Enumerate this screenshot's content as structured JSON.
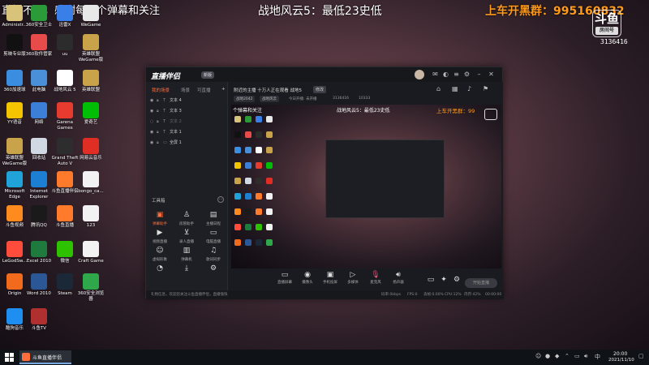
{
  "overlay": {
    "top_left": "直播不易，感谢每一个弹幕和关注",
    "top_center": "战地风云5：最低23史低",
    "top_right": "上车开黑群：995160832",
    "logo_text": "斗鱼",
    "logo_sub": "房间号",
    "room_id": "3136416"
  },
  "desktop_icons": [
    {
      "label": "Administr...",
      "icon": "user-folder-icon",
      "color": "#d9c27a"
    },
    {
      "label": "360安全卫士",
      "icon": "shield-360-icon",
      "color": "#2b9b3a"
    },
    {
      "label": "迅雷X",
      "icon": "thunder-icon",
      "color": "#3a7ee8"
    },
    {
      "label": "WeGame",
      "icon": "wegame-icon",
      "color": "#e8e8e8"
    },
    {
      "label": "剪映专业版",
      "icon": "capcut-icon",
      "color": "#111111"
    },
    {
      "label": "360软件管家",
      "icon": "software-manager-icon",
      "color": "#e94b4b"
    },
    {
      "label": "uu",
      "icon": "uu-icon",
      "color": "#2c2c2c"
    },
    {
      "label": "英雄联盟 WeGame版",
      "icon": "lol-icon",
      "color": "#c9a34a"
    },
    {
      "label": "360加速球",
      "icon": "speed-ball-icon",
      "color": "#3b8de0"
    },
    {
      "label": "此电脑",
      "icon": "computer-icon",
      "color": "#4a90d9"
    },
    {
      "label": "战地风云 5",
      "icon": "battlefield-icon",
      "color": "#ffffff"
    },
    {
      "label": "英雄联盟",
      "icon": "league-icon",
      "color": "#c9a34a"
    },
    {
      "label": "YY语音",
      "icon": "yy-icon",
      "color": "#f5c400"
    },
    {
      "label": "网络",
      "icon": "network-icon",
      "color": "#3c7fd6"
    },
    {
      "label": "Garena Games",
      "icon": "garena-icon",
      "color": "#e63b2e"
    },
    {
      "label": "爱奇艺",
      "icon": "iqiyi-icon",
      "color": "#00be06"
    },
    {
      "label": "英雄联盟 WeGame版",
      "icon": "lol-wegame-icon",
      "color": "#c9a34a"
    },
    {
      "label": "回收站",
      "icon": "recycle-bin-icon",
      "color": "#cfd8e3"
    },
    {
      "label": "Grand Theft Auto V",
      "icon": "gta-icon",
      "color": "#2d2d2d"
    },
    {
      "label": "网易云音乐",
      "icon": "netease-music-icon",
      "color": "#e02e24"
    },
    {
      "label": "Microsoft Edge",
      "icon": "edge-icon",
      "color": "#1fa3d9"
    },
    {
      "label": "Internet Explorer",
      "icon": "ie-icon",
      "color": "#1c7fd4"
    },
    {
      "label": "斗鱼直播伴侣",
      "icon": "douyu-icon",
      "color": "#ff7a2a"
    },
    {
      "label": "bongo_ca...",
      "icon": "file-icon",
      "color": "#f2f2f2"
    },
    {
      "label": "斗鱼视频",
      "icon": "douyu-video-icon",
      "color": "#ff8a1e"
    },
    {
      "label": "腾讯QQ",
      "icon": "qq-icon",
      "color": "#1a1a1a"
    },
    {
      "label": "斗鱼直播",
      "icon": "douyu-live-icon",
      "color": "#ff7a2a"
    },
    {
      "label": "123",
      "icon": "doc-icon",
      "color": "#f2f2f2"
    },
    {
      "label": "LeGodSw...",
      "icon": "legod-icon",
      "color": "#ff4c3b"
    },
    {
      "label": "Excel 2010",
      "icon": "excel-icon",
      "color": "#1f7a3e"
    },
    {
      "label": "微信",
      "icon": "wechat-icon",
      "color": "#2dc100"
    },
    {
      "label": "Craft Game",
      "icon": "craft-doc-icon",
      "color": "#f2f2f2"
    },
    {
      "label": "Origin",
      "icon": "origin-icon",
      "color": "#f26a1b"
    },
    {
      "label": "Word 2010",
      "icon": "word-icon",
      "color": "#2b5797"
    },
    {
      "label": "Steam",
      "icon": "steam-icon",
      "color": "#1b2838"
    },
    {
      "label": "360安全浏览器",
      "icon": "browser-360-icon",
      "color": "#2ea84a"
    },
    {
      "label": "酷狗音乐",
      "icon": "kugou-icon",
      "color": "#1f8ef1"
    },
    {
      "label": "斗鱼TV",
      "icon": "game-icon",
      "color": "#b03030"
    }
  ],
  "app": {
    "logo": "直播伴侣",
    "version": "新版",
    "tabs": [
      "我的场景",
      "场景",
      "可直播"
    ],
    "scenes": [
      {
        "name": "文本 4"
      },
      {
        "name": "文本 3"
      },
      {
        "name": "文本 2"
      },
      {
        "name": "文本 1"
      },
      {
        "name": "全屏 1"
      }
    ],
    "tools_label": "工具箱",
    "tools": [
      {
        "label": "弹幕助手",
        "icon": "danmaku-icon"
      },
      {
        "label": "房管助手",
        "icon": "admin-icon"
      },
      {
        "label": "主播日程",
        "icon": "schedule-icon"
      },
      {
        "label": "视频直播",
        "icon": "video-live-icon"
      },
      {
        "label": "录人直播",
        "icon": "record-icon"
      },
      {
        "label": "电脑直播",
        "icon": "pc-live-icon"
      },
      {
        "label": "虚拟形象",
        "icon": "avatar-virtual-icon"
      },
      {
        "label": "弹幕机",
        "icon": "danmaku-machine-icon"
      },
      {
        "label": "歌词同步",
        "icon": "lyrics-icon"
      },
      {
        "label": "更多",
        "icon": "more-tools-icon"
      },
      {
        "label": "下载",
        "icon": "download-icon"
      },
      {
        "label": "设置",
        "icon": "settings-icon"
      }
    ],
    "stream_title": "附近的主播 十万人正在观看 战地5",
    "edit_label": "修改",
    "tags": [
      "战地2042",
      "战地风云"
    ],
    "stats": [
      "今日开播: 未开播",
      "3136416",
      "10333"
    ],
    "preview": {
      "top_left": "个弹幕和关注",
      "top_center": "战地风云5：最低23史低",
      "top_right": "上车开黑群：99"
    },
    "controls": [
      {
        "label": "直播屏幕",
        "icon": "screen-icon"
      },
      {
        "label": "摄像头",
        "icon": "camera-icon"
      },
      {
        "label": "手机投屏",
        "icon": "phone-cast-icon"
      },
      {
        "label": "多媒体",
        "icon": "media-icon"
      },
      {
        "label": "麦克风",
        "icon": "microphone-icon"
      },
      {
        "label": "扬声器",
        "icon": "speaker-icon"
      }
    ],
    "start_live": "开始直播",
    "status": {
      "notice": "礼物信息，欢迎您关注斗鱼直播伴侣，直播愉快",
      "bitrate": "码率:0kbps",
      "fps": "FPS:0",
      "drop": "丢帧:0.00%",
      "cpu": "CPU:12%",
      "mem": "内存:42%",
      "time": "00:00:00"
    }
  },
  "taskbar": {
    "app_label": "斗鱼直播伴侣",
    "time": "20:00",
    "date": "2021/11/10"
  }
}
